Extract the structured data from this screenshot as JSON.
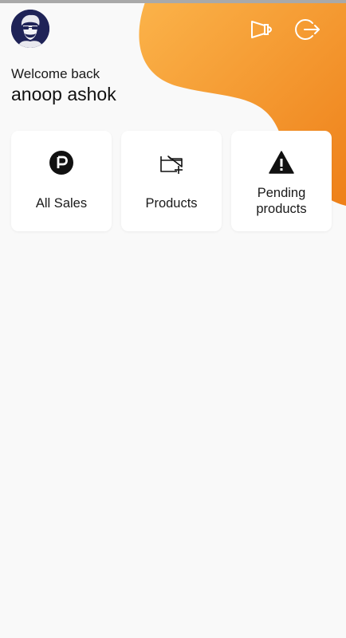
{
  "header": {
    "avatar": "user-avatar",
    "announce_icon": "megaphone-icon",
    "logout_icon": "logout-icon"
  },
  "greeting": {
    "welcome": "Welcome back",
    "name": "anoop ashok"
  },
  "cards": [
    {
      "label": "All Sales",
      "icon": "sales-p-icon"
    },
    {
      "label": "Products",
      "icon": "folder-add-icon"
    },
    {
      "label": "Pending\nproducts",
      "icon": "warning-icon"
    }
  ],
  "colors": {
    "accent_light": "#fbb34a",
    "accent_dark": "#f08a1c",
    "background": "#f9f9f9",
    "avatar_bg": "#1f2357"
  }
}
